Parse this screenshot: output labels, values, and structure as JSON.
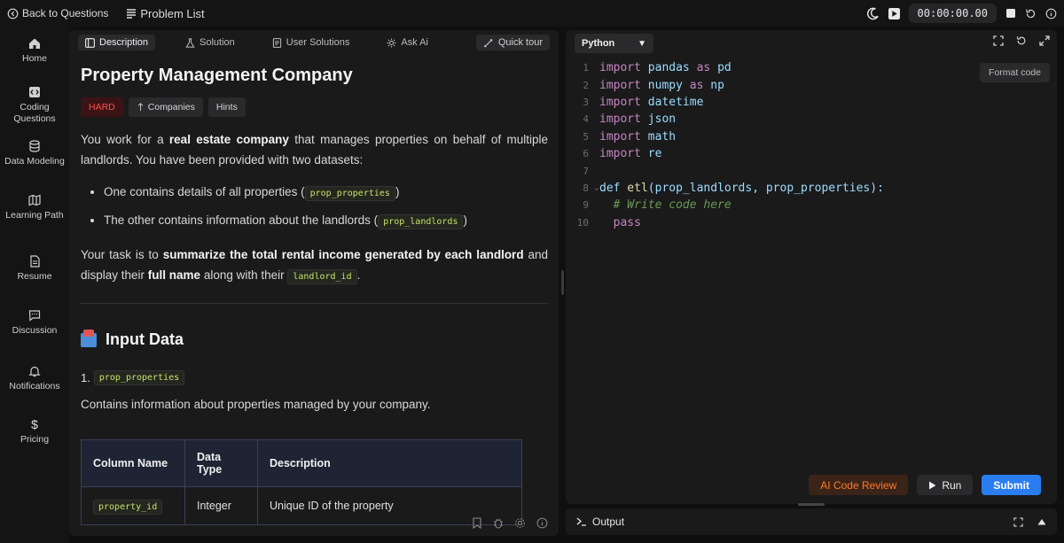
{
  "topbar": {
    "back_label": "Back to Questions",
    "problem_list_label": "Problem List",
    "timer": "00:00:00.00"
  },
  "sidebar": {
    "items": [
      {
        "label": "Home",
        "icon": "home-icon"
      },
      {
        "label": "Coding Questions",
        "icon": "code-icon"
      },
      {
        "label": "Data Modeling",
        "icon": "database-icon"
      },
      {
        "label": "Learning Path",
        "icon": "map-icon"
      },
      {
        "label": "Resume",
        "icon": "document-icon"
      },
      {
        "label": "Discussion",
        "icon": "chat-icon"
      },
      {
        "label": "Notifications",
        "icon": "bell-icon"
      },
      {
        "label": "Pricing",
        "icon": "dollar-icon"
      }
    ]
  },
  "tabs": {
    "description": "Description",
    "solution": "Solution",
    "user_solutions": "User Solutions",
    "ask_ai": "Ask Ai",
    "quick_tour": "Quick tour"
  },
  "problem": {
    "title": "Property Management Company",
    "difficulty": "HARD",
    "companies": "Companies",
    "hints": "Hints",
    "intro_1": "You work for a ",
    "intro_bold": "real estate company",
    "intro_2": " that manages properties on behalf of multiple landlords. You have been provided with two datasets:",
    "bullet_1_text": "One contains details of all properties (",
    "bullet_1_code": "prop_properties",
    "bullet_2_text": "The other contains information about the landlords (",
    "bullet_2_code": "prop_landlords",
    "close_paren": ")",
    "task_1": "Your task is to ",
    "task_bold": "summarize the total rental income generated by each landlord",
    "task_2": " and display their ",
    "task_bold_2": "full name",
    "task_3": " along with their ",
    "task_code": "landlord_id",
    "task_end": ".",
    "input_heading": "Input Data",
    "item_number": "1.",
    "table_name": "prop_properties",
    "table_desc": "Contains information about properties managed by your company.",
    "table": {
      "headers": [
        "Column Name",
        "Data Type",
        "Description"
      ],
      "rows": [
        {
          "name": "property_id",
          "type": "Integer",
          "desc": "Unique ID of the property"
        }
      ]
    }
  },
  "editor": {
    "language": "Python",
    "format_label": "Format code",
    "lines": [
      {
        "n": "1",
        "kw": "import",
        "rest": " pandas ",
        "kw2": "as",
        "rest2": " pd"
      },
      {
        "n": "2",
        "kw": "import",
        "rest": " numpy ",
        "kw2": "as",
        "rest2": " np"
      },
      {
        "n": "3",
        "kw": "import",
        "rest": " datetime",
        "kw2": "",
        "rest2": ""
      },
      {
        "n": "4",
        "kw": "import",
        "rest": " json",
        "kw2": "",
        "rest2": ""
      },
      {
        "n": "5",
        "kw": "import",
        "rest": " math",
        "kw2": "",
        "rest2": ""
      },
      {
        "n": "6",
        "kw": "import",
        "rest": " re",
        "kw2": "",
        "rest2": ""
      },
      {
        "n": "7",
        "kw": "",
        "rest": "",
        "kw2": "",
        "rest2": ""
      }
    ],
    "def_line": {
      "n": "8",
      "kw": "def",
      "fn": " etl",
      "args": "(prop_landlords, prop_properties):"
    },
    "comment_line": {
      "n": "9",
      "text": "  # Write code here"
    },
    "pass_line": {
      "n": "10",
      "text": "  pass"
    },
    "ai_review": "AI Code Review",
    "run": "Run",
    "submit": "Submit",
    "output": "Output"
  }
}
